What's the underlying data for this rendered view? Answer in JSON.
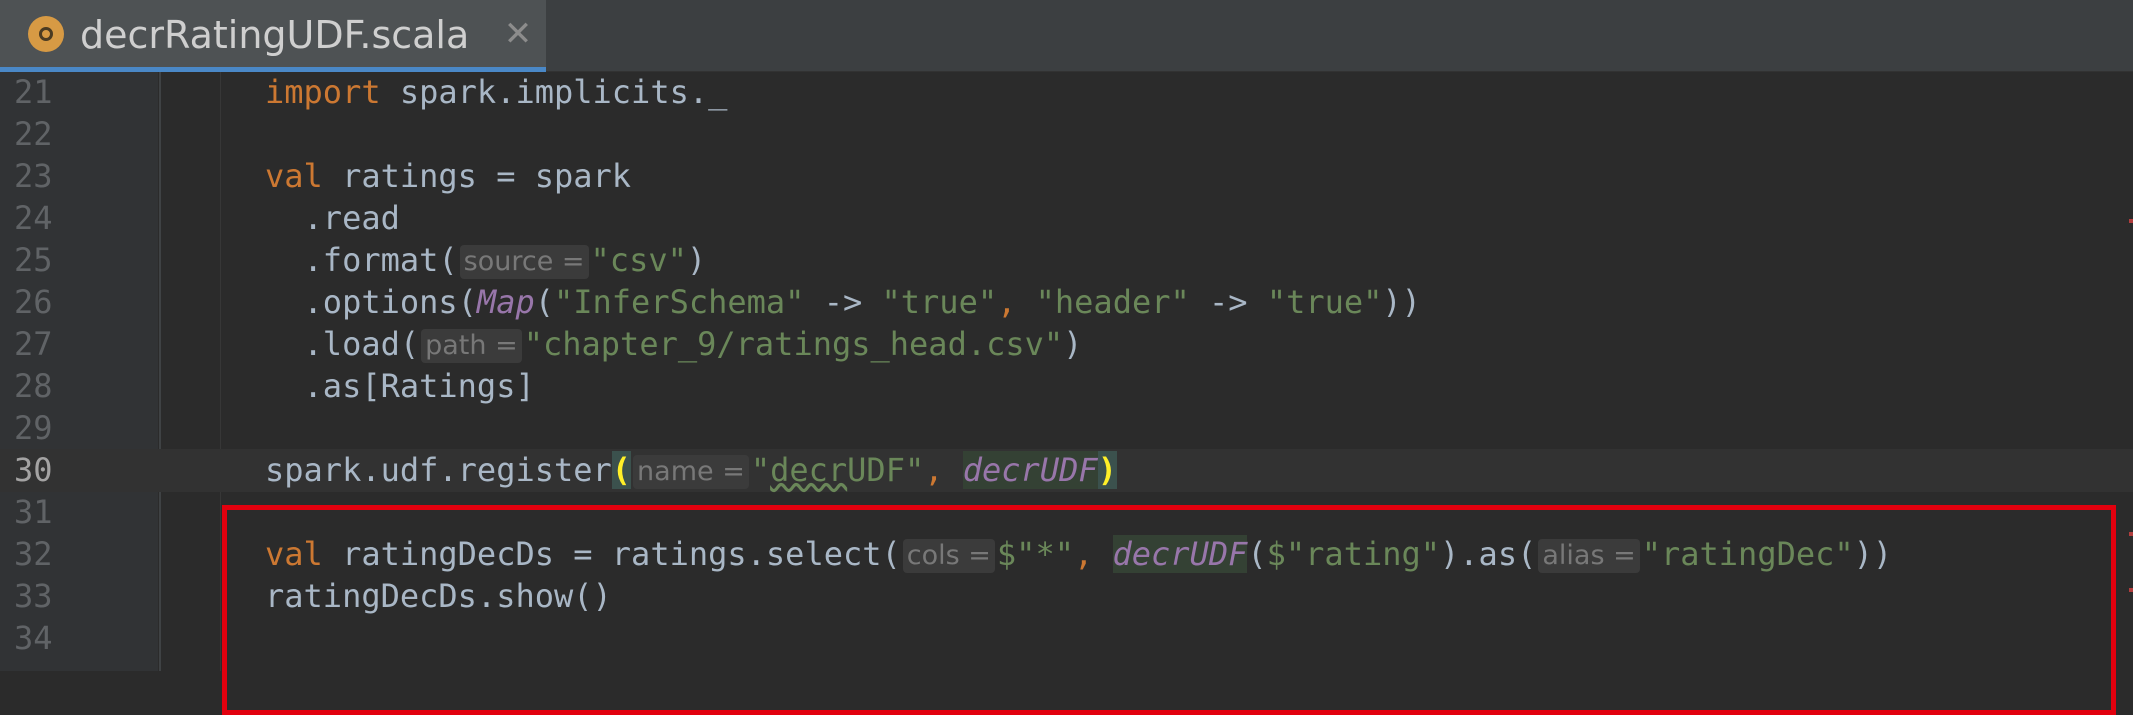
{
  "tab": {
    "filename": "decrRatingUDF.scala",
    "close_glyph": "✕",
    "icon": "scala-object-icon"
  },
  "lines": [
    {
      "num": "21",
      "parts": [
        [
          "kw",
          "import"
        ],
        [
          "p",
          " spark.implicits._"
        ]
      ]
    },
    {
      "num": "22",
      "parts": []
    },
    {
      "num": "23",
      "parts": [
        [
          "kw",
          "val"
        ],
        [
          "p",
          " ratings = spark"
        ]
      ]
    },
    {
      "num": "24",
      "parts": [
        [
          "p",
          "  .read"
        ]
      ]
    },
    {
      "num": "25",
      "parts": [
        [
          "p",
          "  .format("
        ],
        [
          "hint",
          "source ="
        ],
        [
          "str",
          "\"csv\""
        ],
        [
          "p",
          ")"
        ]
      ]
    },
    {
      "num": "26",
      "parts": [
        [
          "p",
          "  .options("
        ],
        [
          "it",
          "Map"
        ],
        [
          "p",
          "("
        ],
        [
          "str",
          "\"InferSchema\""
        ],
        [
          "p",
          " -> "
        ],
        [
          "str",
          "\"true\""
        ],
        [
          "kw",
          ","
        ],
        [
          "p",
          " "
        ],
        [
          "str",
          "\"header\""
        ],
        [
          "p",
          " -> "
        ],
        [
          "str",
          "\"true\""
        ],
        [
          "p",
          "))"
        ]
      ]
    },
    {
      "num": "27",
      "parts": [
        [
          "p",
          "  .load("
        ],
        [
          "hint",
          "path ="
        ],
        [
          "str",
          "\"chapter_9/ratings_head.csv\""
        ],
        [
          "p",
          ")"
        ]
      ]
    },
    {
      "num": "28",
      "parts": [
        [
          "p",
          "  .as[Ratings]"
        ]
      ]
    },
    {
      "num": "29",
      "parts": []
    },
    {
      "num": "30",
      "current": true,
      "parts": [
        [
          "p",
          "spark.udf.register"
        ],
        [
          "match",
          "("
        ],
        [
          "hint",
          "name ="
        ],
        [
          "str",
          "\""
        ],
        [
          "strsq",
          "decr"
        ],
        [
          "str",
          "UDF\""
        ],
        [
          "kw",
          ","
        ],
        [
          "p",
          " "
        ],
        [
          "ithl",
          "decrUDF"
        ],
        [
          "match",
          ")"
        ]
      ]
    },
    {
      "num": "31",
      "parts": []
    },
    {
      "num": "32",
      "parts": [
        [
          "kw",
          "val"
        ],
        [
          "p",
          " ratingDecDs = ratings.select("
        ],
        [
          "hint",
          "cols ="
        ],
        [
          "str",
          "$\"*\""
        ],
        [
          "kw",
          ","
        ],
        [
          "p",
          " "
        ],
        [
          "ithl",
          "decrUDF"
        ],
        [
          "p",
          "("
        ],
        [
          "str",
          "$\"rating\""
        ],
        [
          "p",
          ").as("
        ],
        [
          "hint",
          "alias ="
        ],
        [
          "str",
          "\"ratingDec\""
        ],
        [
          "p",
          "))"
        ]
      ]
    },
    {
      "num": "33",
      "parts": [
        [
          "p",
          "ratingDecDs.show()"
        ]
      ]
    },
    {
      "num": "34",
      "parts": []
    }
  ]
}
